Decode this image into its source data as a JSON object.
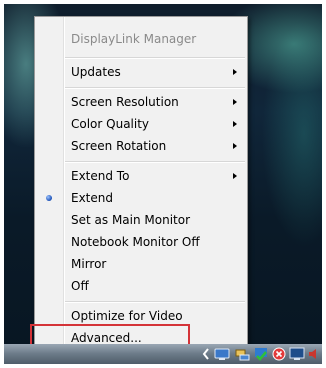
{
  "context_menu": {
    "title": "DisplayLink Manager",
    "items": [
      {
        "label": "Updates",
        "has_submenu": true
      },
      {
        "label": "Screen Resolution",
        "has_submenu": true
      },
      {
        "label": "Color Quality",
        "has_submenu": true
      },
      {
        "label": "Screen Rotation",
        "has_submenu": true
      },
      {
        "label": "Extend To",
        "has_submenu": true
      },
      {
        "label": "Extend",
        "selected": true
      },
      {
        "label": "Set as Main Monitor"
      },
      {
        "label": "Notebook Monitor Off"
      },
      {
        "label": "Mirror"
      },
      {
        "label": "Off"
      },
      {
        "label": "Optimize for Video"
      },
      {
        "label": "Advanced..."
      }
    ]
  },
  "tray_icons": [
    "chevron-left-icon",
    "displaylink-icon",
    "network-icon",
    "security-shield-icon",
    "red-x-icon",
    "monitor-icon",
    "speaker-icon"
  ],
  "colors": {
    "highlight_box": "#d43338",
    "menu_bg": "#f1f1f1"
  }
}
